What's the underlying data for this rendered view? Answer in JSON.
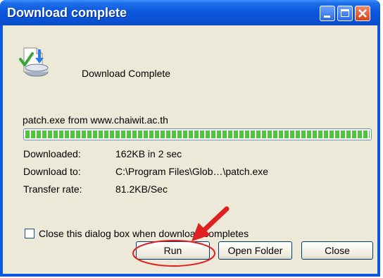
{
  "window": {
    "title": "Download complete"
  },
  "header": {
    "text": "Download Complete",
    "icon": "download-complete-icon"
  },
  "download": {
    "source": "patch.exe from www.chaiwit.ac.th",
    "progress_fraction": 1.0,
    "rows": [
      {
        "label": "Downloaded:",
        "value": "162KB in 2 sec"
      },
      {
        "label": "Download to:",
        "value": "C:\\Program Files\\Glob…\\patch.exe"
      },
      {
        "label": "Transfer rate:",
        "value": "81.2KB/Sec"
      }
    ]
  },
  "options": {
    "close_when_done_label": "Close this dialog box when download completes",
    "close_when_done_checked": false
  },
  "buttons": {
    "run": "Run",
    "open_folder": "Open Folder",
    "close": "Close"
  },
  "colors": {
    "titlebar": "#0a58e0",
    "progress": "#4dc43a",
    "annotation": "#e02020"
  }
}
